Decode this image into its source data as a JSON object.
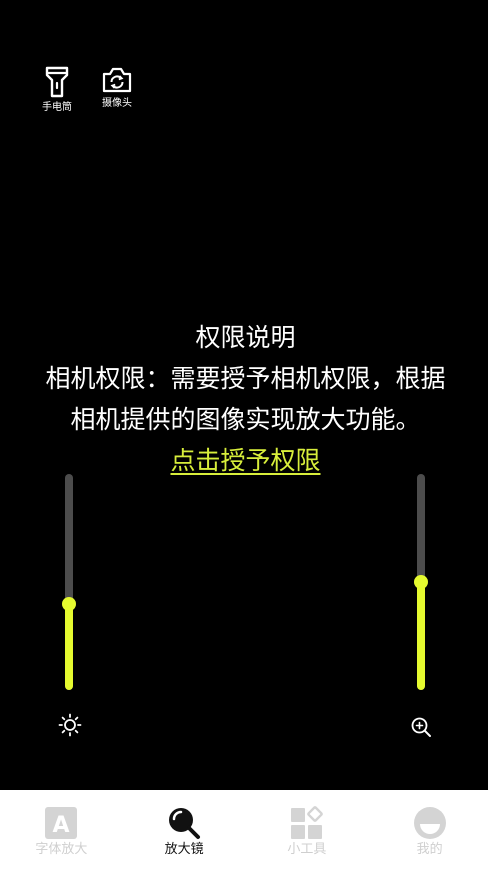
{
  "top_tools": {
    "flashlight": {
      "label": "手电筒",
      "icon": "flashlight-icon"
    },
    "camera": {
      "label": "摄像头",
      "icon": "camera-switch-icon"
    }
  },
  "permission": {
    "title": "权限说明",
    "line1": "相机权限：需要授予相机权限，根据",
    "line2": "相机提供的图像实现放大功能。",
    "grant_link": "点击授予权限"
  },
  "sliders": {
    "brightness": {
      "icon": "brightness-icon",
      "level": 0.4
    },
    "zoom": {
      "icon": "zoom-in-icon",
      "level": 0.5
    }
  },
  "tabs": [
    {
      "label": "字体放大",
      "icon": "font-enlarge-icon",
      "active": false
    },
    {
      "label": "放大镜",
      "icon": "magnifier-icon",
      "active": true
    },
    {
      "label": "小工具",
      "icon": "tools-grid-icon",
      "active": false
    },
    {
      "label": "我的",
      "icon": "profile-icon",
      "active": false
    }
  ],
  "colors": {
    "accent": "#e5fa2f",
    "link": "#d8ee3b",
    "track": "#4c4c4c",
    "inactive_tab": "#cfcfcf"
  }
}
